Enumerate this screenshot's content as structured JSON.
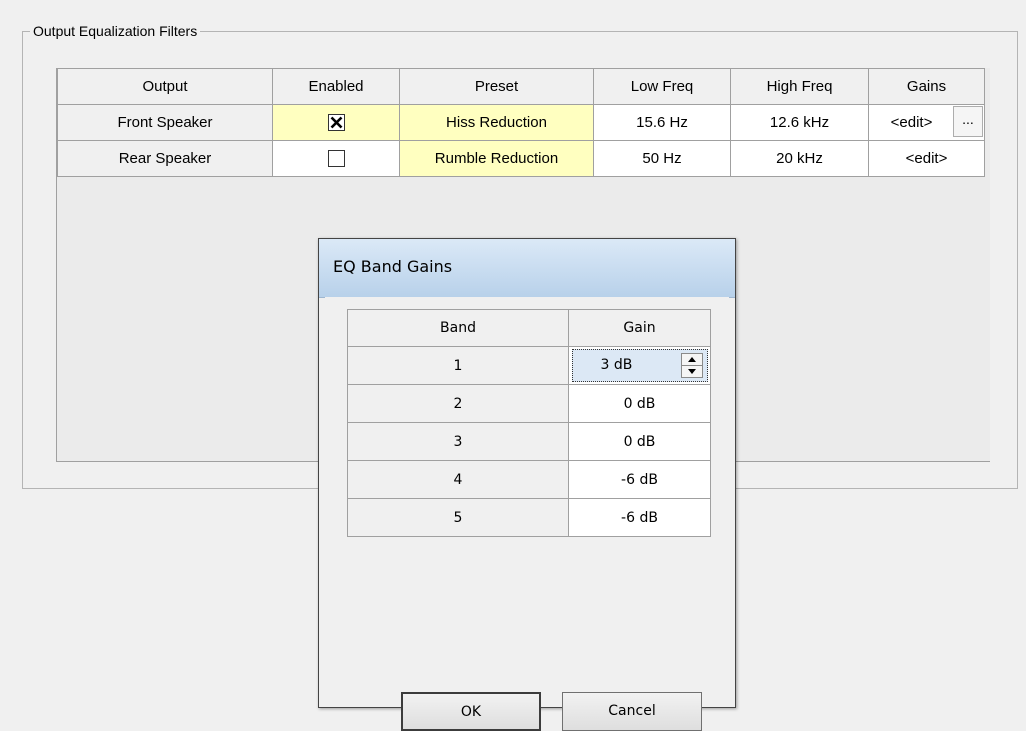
{
  "group": {
    "title": "Output Equalization Filters"
  },
  "grid": {
    "headers": [
      "Output",
      "Enabled",
      "Preset",
      "Low Freq",
      "High Freq",
      "Gains"
    ],
    "rows": [
      {
        "output": "Front Speaker",
        "enabled": true,
        "preset": "Hiss Reduction",
        "low": "15.6 Hz",
        "high": "12.6 kHz",
        "gains": "<edit>",
        "ellipsis": "..."
      },
      {
        "output": "Rear Speaker",
        "enabled": false,
        "preset": "Rumble Reduction",
        "low": "50 Hz",
        "high": "20 kHz",
        "gains": "<edit>"
      }
    ]
  },
  "dialog": {
    "title": "EQ Band Gains",
    "headers": [
      "Band",
      "Gain"
    ],
    "rows": [
      {
        "band": "1",
        "gain": "3 dB"
      },
      {
        "band": "2",
        "gain": "0 dB"
      },
      {
        "band": "3",
        "gain": "0 dB"
      },
      {
        "band": "4",
        "gain": "-6 dB"
      },
      {
        "band": "5",
        "gain": "-6 dB"
      }
    ],
    "ok_label": "OK",
    "cancel_label": "Cancel"
  },
  "colors": {
    "highlight_yellow": "#ffffc0",
    "title_bar": "#c8dcf0"
  }
}
